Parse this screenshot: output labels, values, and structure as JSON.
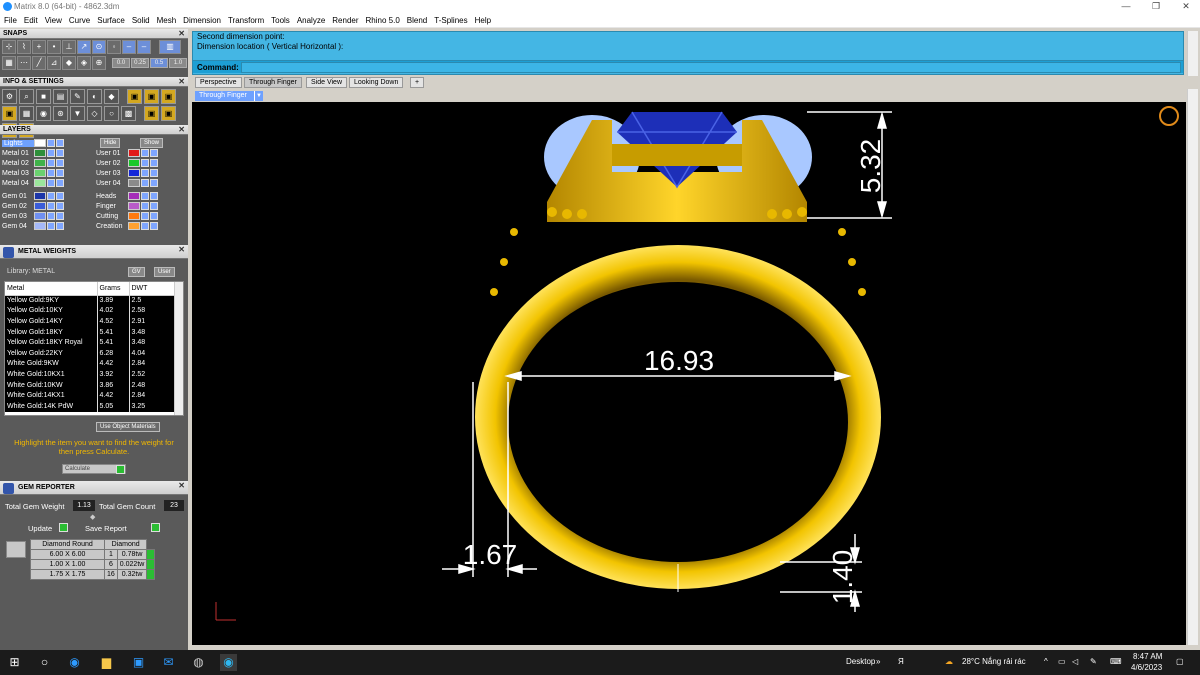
{
  "window": {
    "title": "Matrix 8.0 (64-bit) - 4862.3dm",
    "controls": [
      "—",
      "❐",
      "✕"
    ]
  },
  "menu": [
    "File",
    "Edit",
    "View",
    "Curve",
    "Surface",
    "Solid",
    "Mesh",
    "Dimension",
    "Transform",
    "Tools",
    "Analyze",
    "Render",
    "Rhino 5.0",
    "Blend",
    "T-Splines",
    "Help"
  ],
  "panels": {
    "snaps": {
      "title": "SNAPS",
      "fields": [
        "0.0",
        "0.25",
        "0.5",
        "1.0"
      ]
    },
    "info": {
      "title": "INFO & SETTINGS"
    },
    "layers": {
      "title": "LAYERS",
      "hide_label": "Hide",
      "show_label": "Show",
      "left": [
        {
          "name": "Lights",
          "color": "#ffffff"
        },
        {
          "name": "Metal 01",
          "color": "#2e8f3a"
        },
        {
          "name": "Metal 02",
          "color": "#3fb24a"
        },
        {
          "name": "Metal 03",
          "color": "#6ad16f"
        },
        {
          "name": "Metal 04",
          "color": "#9be79c"
        },
        {
          "name": "Gem 01",
          "color": "#1c36a8"
        },
        {
          "name": "Gem 02",
          "color": "#3a5cd8"
        },
        {
          "name": "Gem 03",
          "color": "#6f8ff0"
        },
        {
          "name": "Gem 04",
          "color": "#a4b8f8"
        }
      ],
      "right": [
        {
          "name": "User 01",
          "color": "#e21818"
        },
        {
          "name": "User 02",
          "color": "#18c828"
        },
        {
          "name": "User 03",
          "color": "#1426d8"
        },
        {
          "name": "User 04",
          "color": "#8a8a8a"
        },
        {
          "name": "Heads",
          "color": "#a42cb8"
        },
        {
          "name": "Finger",
          "color": "#b85cc8"
        },
        {
          "name": "Cutting",
          "color": "#ff7a10"
        },
        {
          "name": "Creation",
          "color": "#ffa030"
        }
      ]
    },
    "metal_weights": {
      "title": "METAL WEIGHTS",
      "library": "Library: METAL",
      "toggle_a": "GV",
      "toggle_b": "User",
      "columns": [
        "Metal",
        "Grams",
        "DWT"
      ],
      "rows": [
        [
          "Yellow Gold:9KY",
          "3.89",
          "2.5"
        ],
        [
          "Yellow Gold:10KY",
          "4.02",
          "2.58"
        ],
        [
          "Yellow Gold:14KY",
          "4.52",
          "2.91"
        ],
        [
          "Yellow Gold:18KY",
          "5.41",
          "3.48"
        ],
        [
          "Yellow Gold:18KY Royal",
          "5.41",
          "3.48"
        ],
        [
          "Yellow Gold:22KY",
          "6.28",
          "4.04"
        ],
        [
          "White Gold:9KW",
          "4.42",
          "2.84"
        ],
        [
          "White Gold:10KX1",
          "3.92",
          "2.52"
        ],
        [
          "White Gold:10KW",
          "3.86",
          "2.48"
        ],
        [
          "White Gold:14KX1",
          "4.42",
          "2.84"
        ],
        [
          "White Gold:14K PdW",
          "5.05",
          "3.25"
        ]
      ],
      "use_object_materials": "Use Object Materials",
      "hint": "Highlight the item you want to find the weight for then press Calculate.",
      "calculate": "Calculate"
    },
    "gem_reporter": {
      "title": "GEM REPORTER",
      "total_weight_label": "Total Gem Weight",
      "total_weight": "1.13",
      "total_count_label": "Total Gem Count",
      "total_count": "23",
      "update": "Update",
      "save_report": "Save Report",
      "headers": [
        "Diamond Round",
        "Diamond"
      ],
      "rows": [
        [
          "6.00 X 6.00",
          "1",
          "0.78tw"
        ],
        [
          "1.00 X 1.00",
          "6",
          "0.022tw"
        ],
        [
          "1.75 X 1.75",
          "16",
          "0.32tw"
        ]
      ]
    }
  },
  "command": {
    "line1": "Second dimension point:",
    "line2": "Dimension location ( Vertical  Horizontal ):",
    "label": "Command:"
  },
  "tabs": [
    "Perspective",
    "Through Finger",
    "Side View",
    "Looking Down",
    "+"
  ],
  "viewport_label": "Through Finger",
  "dimensions": {
    "width": "16.93",
    "height": "5.32",
    "band_width": "1.67",
    "band_thickness": "1.40"
  },
  "colors": {
    "gold": "#e6b800",
    "gem": "#1d2fb8",
    "accent": "#44b6e4"
  },
  "taskbar": {
    "desktop": "Desktop",
    "weather": "28°C  Nắng rải rác",
    "time": "8:47 AM",
    "date": "4/6/2023"
  }
}
